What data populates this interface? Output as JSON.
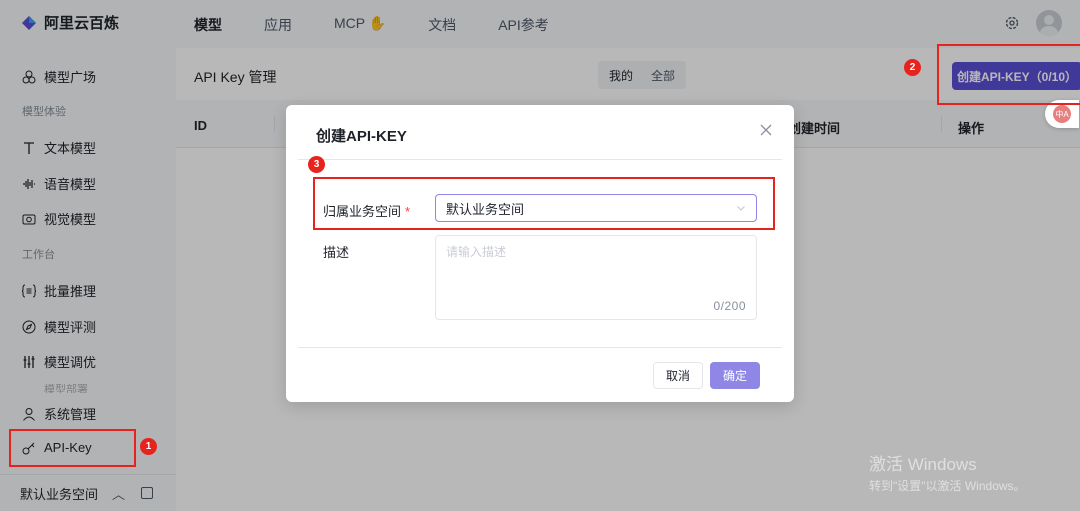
{
  "app": {
    "name": "阿里云百炼"
  },
  "topnav": {
    "items": [
      "模型",
      "应用",
      "MCP",
      "文档",
      "API参考"
    ],
    "mcp_emoji": "✋"
  },
  "sidebar": {
    "square": "模型广场",
    "group_experience": "模型体验",
    "text_model": "文本模型",
    "voice_model": "语音模型",
    "vision_model": "视觉模型",
    "group_workbench": "工作台",
    "batch_infer": "批量推理",
    "model_eval": "模型评测",
    "model_tune": "模型调优",
    "model_deploy_partial": "模型部署",
    "sys_admin": "系统管理",
    "api_key": "API-Key",
    "workspace": "默认业务空间"
  },
  "main": {
    "title": "API Key 管理",
    "seg_mine": "我的",
    "seg_all": "全部",
    "create_button": "创建API-KEY（0/10）",
    "columns": {
      "id": "ID",
      "created": "创建时间",
      "actions": "操作"
    }
  },
  "modal": {
    "title": "创建API-KEY",
    "workspace_label": "归属业务空间",
    "required_mark": "*",
    "workspace_value": "默认业务空间",
    "desc_label": "描述",
    "desc_placeholder": "请输入描述",
    "desc_counter": "0/200",
    "cancel": "取消",
    "confirm": "确定"
  },
  "annotations": {
    "b1": "1",
    "b2": "2",
    "b3": "3"
  },
  "translate_fab": "中A",
  "watermark": {
    "line1": "激活 Windows",
    "line2": "转到\"设置\"以激活 Windows。"
  },
  "colors": {
    "accent": "#5b4fd6",
    "highlight": "#e8231d"
  }
}
